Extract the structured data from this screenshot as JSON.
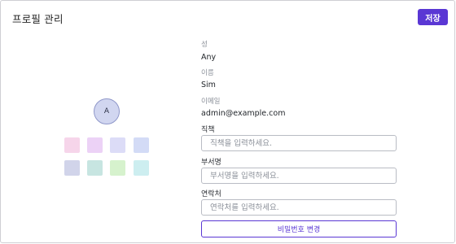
{
  "header": {
    "title": "프로필 관리",
    "save_label": "저장"
  },
  "avatar": {
    "initial": "A"
  },
  "swatches": [
    {
      "color": "#f6d5ea"
    },
    {
      "color": "#ecd2f6"
    },
    {
      "color": "#dcdcf7"
    },
    {
      "color": "#d3dbf6"
    },
    {
      "color": "#d1d4ea"
    },
    {
      "color": "#c7e5e1"
    },
    {
      "color": "#d6f2cd"
    },
    {
      "color": "#cdeef0"
    }
  ],
  "profile": {
    "last_name_label": "성",
    "last_name_value": "Any",
    "first_name_label": "이름",
    "first_name_value": "Sim",
    "email_label": "이메일",
    "email_value": "admin@example.com"
  },
  "form": {
    "position_label": "직책",
    "position_placeholder": "직책을 입력하세요.",
    "department_label": "부서명",
    "department_placeholder": "부서명을 입력하세요.",
    "contact_label": "연락처",
    "contact_placeholder": "연락처를 입력하세요.",
    "change_password_label": "비밀번호 변경"
  },
  "colors": {
    "accent": "#5a37d4",
    "avatar_fill": "#d1d6f0",
    "avatar_border": "#8f97c9"
  }
}
